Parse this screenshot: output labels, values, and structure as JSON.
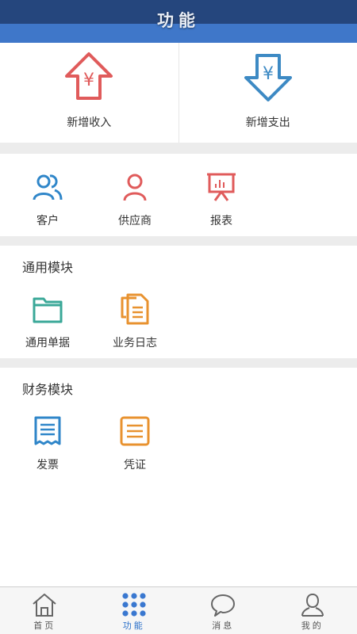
{
  "header": {
    "title": "功能"
  },
  "quick": {
    "income_label": "新增收入",
    "expense_label": "新增支出",
    "currency_symbol": "¥"
  },
  "basic": {
    "items": [
      {
        "label": "客户",
        "icon": "users-icon"
      },
      {
        "label": "供应商",
        "icon": "person-icon"
      },
      {
        "label": "报表",
        "icon": "chart-board-icon"
      }
    ]
  },
  "general_module": {
    "title": "通用模块",
    "items": [
      {
        "label": "通用单据",
        "icon": "folder-icon"
      },
      {
        "label": "业务日志",
        "icon": "documents-icon"
      }
    ]
  },
  "finance_module": {
    "title": "财务模块",
    "items": [
      {
        "label": "发票",
        "icon": "receipt-icon"
      },
      {
        "label": "凭证",
        "icon": "voucher-icon"
      }
    ]
  },
  "tabbar": {
    "tabs": [
      {
        "label": "首页",
        "icon": "home-icon"
      },
      {
        "label": "功能",
        "icon": "grid-dots-icon",
        "active": true
      },
      {
        "label": "消息",
        "icon": "chat-bubble-icon"
      },
      {
        "label": "我的",
        "icon": "user-icon"
      }
    ]
  },
  "colors": {
    "header_dark": "#25467d",
    "header_light": "#3f77c9",
    "income_red": "#e05b5b",
    "expense_blue": "#3d8ac4",
    "orange": "#e8922f",
    "teal": "#3aa898",
    "active_tab": "#2a6fc9"
  }
}
